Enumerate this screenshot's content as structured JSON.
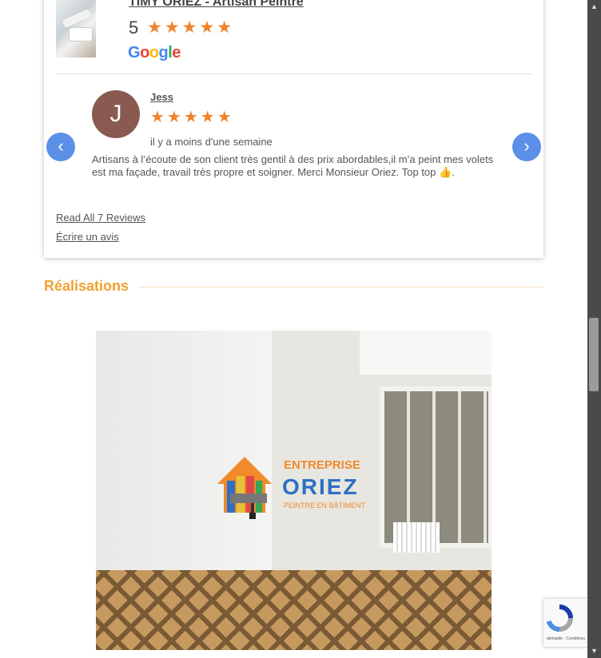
{
  "business": {
    "name": "TIMY ORIEZ - Artisan Peintre",
    "rating": "5",
    "stars": "★★★★★",
    "google_label": {
      "g1": "G",
      "o1": "o",
      "o2": "o",
      "g2": "g",
      "l": "l",
      "e": "e"
    }
  },
  "review": {
    "avatar_letter": "J",
    "author": "Jess",
    "stars": "★★★★★",
    "date": "il y a moins d'une semaine",
    "text": "Artisans à l’écoute de son client très gentil à des prix abordables,il m’a peint mes volets est ma façade, travail très propre et soigner. Merci Monsieur Oriez. Top top 👍."
  },
  "carousel": {
    "prev_icon": "‹",
    "next_icon": "›"
  },
  "links": {
    "read_all": "Read All 7 Reviews",
    "write": "Écrire un avis"
  },
  "section": {
    "title": "Réalisations"
  },
  "gallery_logo": {
    "line1": "ENTREPRISE",
    "line2": "ORIEZ",
    "line3": "PEINTRE EN BÂTIMENT"
  },
  "recaptcha": {
    "text": "dentialité - Conditions"
  },
  "scrollbar": {
    "up": "▲",
    "down": "▼"
  },
  "colors": {
    "star": "#f0832a",
    "section_title": "#f0a030",
    "nav_button": "#5b8fe8",
    "avatar": "#8a5a50"
  }
}
